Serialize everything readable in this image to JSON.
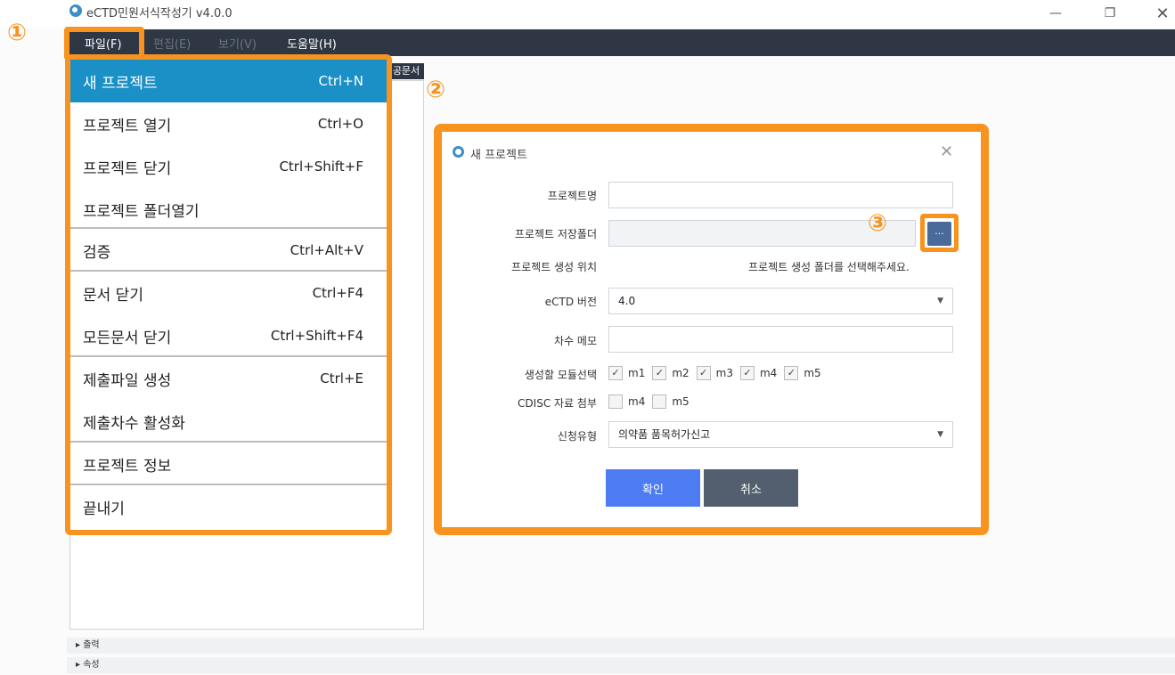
{
  "window": {
    "title": "eCTD민원서식작성기 v4.0.0",
    "min_glyph": "—",
    "max_glyph": "❐",
    "close_glyph": "✕"
  },
  "menubar": {
    "file": "파일(F)",
    "edit": "편집(E)",
    "view": "보기(V)",
    "help": "도움말(H)"
  },
  "tab_stub": "공문서",
  "file_menu": {
    "items": [
      {
        "label": "새 프로젝트",
        "shortcut": "Ctrl+N"
      },
      {
        "label": "프로젝트 열기",
        "shortcut": "Ctrl+O"
      },
      {
        "label": "프로젝트 닫기",
        "shortcut": "Ctrl+Shift+F"
      },
      {
        "label": "프로젝트 폴더열기",
        "shortcut": ""
      },
      {
        "label": "검증",
        "shortcut": "Ctrl+Alt+V"
      },
      {
        "label": "문서 닫기",
        "shortcut": "Ctrl+F4"
      },
      {
        "label": "모든문서 닫기",
        "shortcut": "Ctrl+Shift+F4"
      },
      {
        "label": "제출파일 생성",
        "shortcut": "Ctrl+E"
      },
      {
        "label": "제출차수 활성화",
        "shortcut": ""
      },
      {
        "label": "프로젝트 정보",
        "shortcut": ""
      },
      {
        "label": "끝내기",
        "shortcut": ""
      }
    ]
  },
  "steps": {
    "one": "①",
    "two": "②",
    "three": "③"
  },
  "dialog": {
    "title": "새 프로젝트",
    "close_glyph": "✕",
    "project_name_label": "프로젝트명",
    "project_name_value": "",
    "save_folder_label": "프로젝트 저장폴더",
    "save_folder_value": "",
    "browse_label": "...",
    "location_label": "프로젝트 생성 위치",
    "location_hint": "프로젝트 생성 폴더를 선택해주세요.",
    "ectd_version_label": "eCTD 버전",
    "ectd_version_value": "4.0",
    "memo_label": "차수 메모",
    "memo_value": "",
    "modules_label": "생성할 모듈선택",
    "modules": [
      {
        "name": "m1",
        "checked": true
      },
      {
        "name": "m2",
        "checked": true
      },
      {
        "name": "m3",
        "checked": true
      },
      {
        "name": "m4",
        "checked": true
      },
      {
        "name": "m5",
        "checked": true
      }
    ],
    "cdisc_label": "CDISC 자료 첨부",
    "cdisc": [
      {
        "name": "m4",
        "checked": false
      },
      {
        "name": "m5",
        "checked": false
      }
    ],
    "apply_type_label": "신청유형",
    "apply_type_value": "의약품 품목허가신고",
    "ok_label": "확인",
    "cancel_label": "취소",
    "check_glyph": "✓",
    "arrow_glyph": "▼"
  },
  "bottom": {
    "output_label": "▸ 출력",
    "props_label": "▸ 속성"
  },
  "colors": {
    "highlight": "#f7931e",
    "menubar": "#2f3744",
    "menu_active": "#1a90c7",
    "ok_button": "#4d7cf2",
    "cancel_button": "#535f6e"
  }
}
